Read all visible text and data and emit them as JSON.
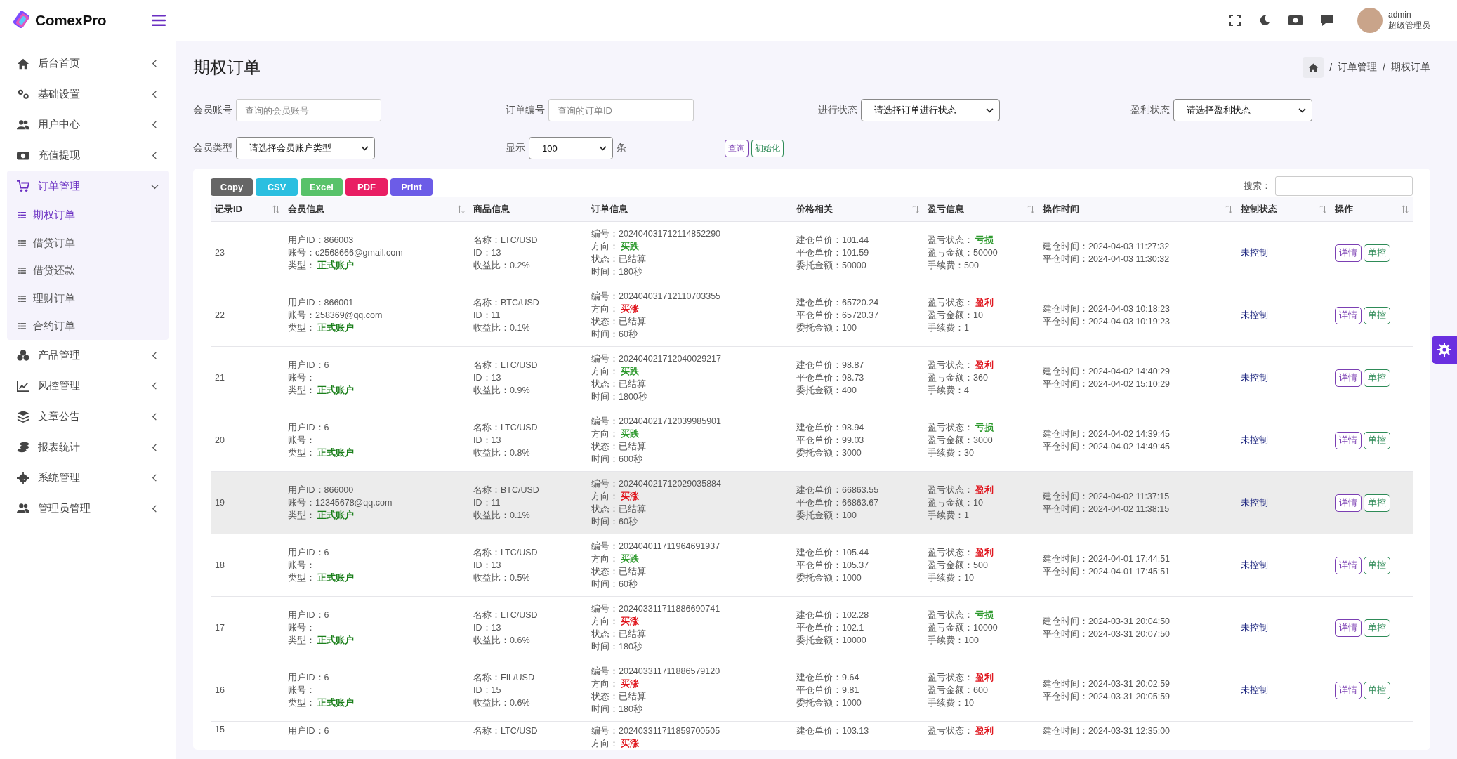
{
  "brand": "ComexPro",
  "sidebar": {
    "items": [
      {
        "label": "后台首页",
        "expanded": false
      },
      {
        "label": "基础设置",
        "expanded": false
      },
      {
        "label": "用户中心",
        "expanded": false
      },
      {
        "label": "充值提现",
        "expanded": false
      },
      {
        "label": "订单管理",
        "expanded": true,
        "children": [
          {
            "label": "期权订单",
            "selected": true
          },
          {
            "label": "借贷订单",
            "selected": false
          },
          {
            "label": "借贷还款",
            "selected": false
          },
          {
            "label": "理财订单",
            "selected": false
          },
          {
            "label": "合约订单",
            "selected": false
          }
        ]
      },
      {
        "label": "产品管理",
        "expanded": false
      },
      {
        "label": "风控管理",
        "expanded": false
      },
      {
        "label": "文章公告",
        "expanded": false
      },
      {
        "label": "报表统计",
        "expanded": false
      },
      {
        "label": "系统管理",
        "expanded": false
      },
      {
        "label": "管理员管理",
        "expanded": false
      }
    ]
  },
  "user": {
    "name": "admin",
    "role": "超级管理员"
  },
  "page_title": "期权订单",
  "breadcrumb": [
    "订单管理",
    "期权订单"
  ],
  "breadcrumb_separator": "/",
  "filter_rows": [
    [
      {
        "kind": "input",
        "label": "会员账号",
        "placeholder": "查询的会员账号"
      },
      {
        "kind": "input",
        "label": "订单编号",
        "placeholder": "查询的订单ID"
      },
      {
        "kind": "select",
        "label": "进行状态",
        "value": "请选择订单进行状态"
      },
      {
        "kind": "select",
        "label": "盈利状态",
        "value": "请选择盈利状态"
      }
    ],
    [
      {
        "kind": "select",
        "label": "会员类型",
        "value": "请选择会员账户类型"
      },
      {
        "kind": "select",
        "label": "显示",
        "value": "100",
        "suffix": "条"
      }
    ]
  ],
  "filter_buttons": [
    "查询",
    "初始化"
  ],
  "export_buttons": [
    "Copy",
    "CSV",
    "Excel",
    "PDF",
    "Print"
  ],
  "search_label": "搜索：",
  "table": {
    "columns": [
      {
        "label": "记录ID",
        "sortable": true
      },
      {
        "label": "会员信息",
        "sortable": true
      },
      {
        "label": "商品信息",
        "sortable": false
      },
      {
        "label": "订单信息",
        "sortable": false
      },
      {
        "label": "价格相关",
        "sortable": true
      },
      {
        "label": "盈亏信息",
        "sortable": true
      },
      {
        "label": "操作时间",
        "sortable": true
      },
      {
        "label": "控制状态",
        "sortable": true
      },
      {
        "label": "操作",
        "sortable": true
      }
    ],
    "rows": [
      {
        "id": "23",
        "highlighted": false,
        "member": [
          {
            "label": "用户ID：",
            "value": "866003"
          },
          {
            "label": "账号：",
            "value": "c2568666@gmail.com"
          },
          {
            "label": "类型： ",
            "value": "正式账户",
            "color": "#1a7f1a"
          }
        ],
        "product": [
          {
            "label": "名称：",
            "value": "LTC/USD"
          },
          {
            "label": "ID：",
            "value": "13"
          },
          {
            "label": "收益比：",
            "value": "0.2%"
          }
        ],
        "order": [
          {
            "label": "编号：",
            "value": "202404031712114852290"
          },
          {
            "label": "方向： ",
            "value": "买跌",
            "color": "#2e9a2e"
          },
          {
            "label": "状态：",
            "value": "已结算"
          },
          {
            "label": "时间：",
            "value": "180秒"
          }
        ],
        "price": [
          {
            "label": "建仓单价：",
            "value": "101.44"
          },
          {
            "label": "平仓单价：",
            "value": "101.59"
          },
          {
            "label": "委托金额：",
            "value": "50000"
          }
        ],
        "pnl": [
          {
            "label": "盈亏状态： ",
            "value": "亏损",
            "color": "#2e9a2e"
          },
          {
            "label": "盈亏金额：",
            "value": "50000"
          },
          {
            "label": "手续费：",
            "value": "500"
          }
        ],
        "time": [
          {
            "label": "建仓时间：",
            "value": "2024-04-03 11:27:32"
          },
          {
            "label": "平仓时间：",
            "value": "2024-04-03 11:30:32"
          }
        ],
        "control": "未控制",
        "actions": [
          "详情",
          "单控"
        ]
      },
      {
        "id": "22",
        "highlighted": false,
        "member": [
          {
            "label": "用户ID：",
            "value": "866001"
          },
          {
            "label": "账号：",
            "value": "258369@qq.com"
          },
          {
            "label": "类型： ",
            "value": "正式账户",
            "color": "#1a7f1a"
          }
        ],
        "product": [
          {
            "label": "名称：",
            "value": "BTC/USD"
          },
          {
            "label": "ID：",
            "value": "11"
          },
          {
            "label": "收益比：",
            "value": "0.1%"
          }
        ],
        "order": [
          {
            "label": "编号：",
            "value": "202404031712110703355"
          },
          {
            "label": "方向： ",
            "value": "买涨",
            "color": "#e0161e"
          },
          {
            "label": "状态：",
            "value": "已结算"
          },
          {
            "label": "时间：",
            "value": "60秒"
          }
        ],
        "price": [
          {
            "label": "建仓单价：",
            "value": "65720.24"
          },
          {
            "label": "平仓单价：",
            "value": "65720.37"
          },
          {
            "label": "委托金额：",
            "value": "100"
          }
        ],
        "pnl": [
          {
            "label": "盈亏状态： ",
            "value": "盈利",
            "color": "#e0161e"
          },
          {
            "label": "盈亏金额：",
            "value": "10"
          },
          {
            "label": "手续费：",
            "value": "1"
          }
        ],
        "time": [
          {
            "label": "建仓时间：",
            "value": "2024-04-03 10:18:23"
          },
          {
            "label": "平仓时间：",
            "value": "2024-04-03 10:19:23"
          }
        ],
        "control": "未控制",
        "actions": [
          "详情",
          "单控"
        ]
      },
      {
        "id": "21",
        "highlighted": false,
        "member": [
          {
            "label": "用户ID：",
            "value": "6"
          },
          {
            "label": "账号："
          },
          {
            "label": "类型： ",
            "value": "正式账户",
            "color": "#1a7f1a"
          }
        ],
        "product": [
          {
            "label": "名称：",
            "value": "LTC/USD"
          },
          {
            "label": "ID：",
            "value": "13"
          },
          {
            "label": "收益比：",
            "value": "0.9%"
          }
        ],
        "order": [
          {
            "label": "编号：",
            "value": "202404021712040029217"
          },
          {
            "label": "方向： ",
            "value": "买跌",
            "color": "#2e9a2e"
          },
          {
            "label": "状态：",
            "value": "已结算"
          },
          {
            "label": "时间：",
            "value": "1800秒"
          }
        ],
        "price": [
          {
            "label": "建仓单价：",
            "value": "98.87"
          },
          {
            "label": "平仓单价：",
            "value": "98.73"
          },
          {
            "label": "委托金额：",
            "value": "400"
          }
        ],
        "pnl": [
          {
            "label": "盈亏状态： ",
            "value": "盈利",
            "color": "#e0161e"
          },
          {
            "label": "盈亏金额：",
            "value": "360"
          },
          {
            "label": "手续费：",
            "value": "4"
          }
        ],
        "time": [
          {
            "label": "建仓时间：",
            "value": "2024-04-02 14:40:29"
          },
          {
            "label": "平仓时间：",
            "value": "2024-04-02 15:10:29"
          }
        ],
        "control": "未控制",
        "actions": [
          "详情",
          "单控"
        ]
      },
      {
        "id": "20",
        "highlighted": false,
        "member": [
          {
            "label": "用户ID：",
            "value": "6"
          },
          {
            "label": "账号："
          },
          {
            "label": "类型： ",
            "value": "正式账户",
            "color": "#1a7f1a"
          }
        ],
        "product": [
          {
            "label": "名称：",
            "value": "LTC/USD"
          },
          {
            "label": "ID：",
            "value": "13"
          },
          {
            "label": "收益比：",
            "value": "0.8%"
          }
        ],
        "order": [
          {
            "label": "编号：",
            "value": "202404021712039985901"
          },
          {
            "label": "方向： ",
            "value": "买跌",
            "color": "#2e9a2e"
          },
          {
            "label": "状态：",
            "value": "已结算"
          },
          {
            "label": "时间：",
            "value": "600秒"
          }
        ],
        "price": [
          {
            "label": "建仓单价：",
            "value": "98.94"
          },
          {
            "label": "平仓单价：",
            "value": "99.03"
          },
          {
            "label": "委托金额：",
            "value": "3000"
          }
        ],
        "pnl": [
          {
            "label": "盈亏状态： ",
            "value": "亏损",
            "color": "#2e9a2e"
          },
          {
            "label": "盈亏金额：",
            "value": "3000"
          },
          {
            "label": "手续费：",
            "value": "30"
          }
        ],
        "time": [
          {
            "label": "建仓时间：",
            "value": "2024-04-02 14:39:45"
          },
          {
            "label": "平仓时间：",
            "value": "2024-04-02 14:49:45"
          }
        ],
        "control": "未控制",
        "actions": [
          "详情",
          "单控"
        ]
      },
      {
        "id": "19",
        "highlighted": true,
        "member": [
          {
            "label": "用户ID：",
            "value": "866000"
          },
          {
            "label": "账号：",
            "value": "12345678@qq.com"
          },
          {
            "label": "类型： ",
            "value": "正式账户",
            "color": "#1a7f1a"
          }
        ],
        "product": [
          {
            "label": "名称：",
            "value": "BTC/USD"
          },
          {
            "label": "ID：",
            "value": "11"
          },
          {
            "label": "收益比：",
            "value": "0.1%"
          }
        ],
        "order": [
          {
            "label": "编号：",
            "value": "202404021712029035884"
          },
          {
            "label": "方向： ",
            "value": "买涨",
            "color": "#e0161e"
          },
          {
            "label": "状态：",
            "value": "已结算"
          },
          {
            "label": "时间：",
            "value": "60秒"
          }
        ],
        "price": [
          {
            "label": "建仓单价：",
            "value": "66863.55"
          },
          {
            "label": "平仓单价：",
            "value": "66863.67"
          },
          {
            "label": "委托金额：",
            "value": "100"
          }
        ],
        "pnl": [
          {
            "label": "盈亏状态： ",
            "value": "盈利",
            "color": "#e0161e"
          },
          {
            "label": "盈亏金额：",
            "value": "10"
          },
          {
            "label": "手续费：",
            "value": "1"
          }
        ],
        "time": [
          {
            "label": "建仓时间：",
            "value": "2024-04-02 11:37:15"
          },
          {
            "label": "平仓时间：",
            "value": "2024-04-02 11:38:15"
          }
        ],
        "control": "未控制",
        "actions": [
          "详情",
          "单控"
        ]
      },
      {
        "id": "18",
        "highlighted": false,
        "member": [
          {
            "label": "用户ID：",
            "value": "6"
          },
          {
            "label": "账号："
          },
          {
            "label": "类型： ",
            "value": "正式账户",
            "color": "#1a7f1a"
          }
        ],
        "product": [
          {
            "label": "名称：",
            "value": "LTC/USD"
          },
          {
            "label": "ID：",
            "value": "13"
          },
          {
            "label": "收益比：",
            "value": "0.5%"
          }
        ],
        "order": [
          {
            "label": "编号：",
            "value": "202404011711964691937"
          },
          {
            "label": "方向： ",
            "value": "买跌",
            "color": "#2e9a2e"
          },
          {
            "label": "状态：",
            "value": "已结算"
          },
          {
            "label": "时间：",
            "value": "60秒"
          }
        ],
        "price": [
          {
            "label": "建仓单价：",
            "value": "105.44"
          },
          {
            "label": "平仓单价：",
            "value": "105.37"
          },
          {
            "label": "委托金额：",
            "value": "1000"
          }
        ],
        "pnl": [
          {
            "label": "盈亏状态： ",
            "value": "盈利",
            "color": "#e0161e"
          },
          {
            "label": "盈亏金额：",
            "value": "500"
          },
          {
            "label": "手续费：",
            "value": "10"
          }
        ],
        "time": [
          {
            "label": "建仓时间：",
            "value": "2024-04-01 17:44:51"
          },
          {
            "label": "平仓时间：",
            "value": "2024-04-01 17:45:51"
          }
        ],
        "control": "未控制",
        "actions": [
          "详情",
          "单控"
        ]
      },
      {
        "id": "17",
        "highlighted": false,
        "member": [
          {
            "label": "用户ID：",
            "value": "6"
          },
          {
            "label": "账号："
          },
          {
            "label": "类型： ",
            "value": "正式账户",
            "color": "#1a7f1a"
          }
        ],
        "product": [
          {
            "label": "名称：",
            "value": "LTC/USD"
          },
          {
            "label": "ID：",
            "value": "13"
          },
          {
            "label": "收益比：",
            "value": "0.6%"
          }
        ],
        "order": [
          {
            "label": "编号：",
            "value": "202403311711886690741"
          },
          {
            "label": "方向： ",
            "value": "买涨",
            "color": "#e0161e"
          },
          {
            "label": "状态：",
            "value": "已结算"
          },
          {
            "label": "时间：",
            "value": "180秒"
          }
        ],
        "price": [
          {
            "label": "建仓单价：",
            "value": "102.28"
          },
          {
            "label": "平仓单价：",
            "value": "102.1"
          },
          {
            "label": "委托金额：",
            "value": "10000"
          }
        ],
        "pnl": [
          {
            "label": "盈亏状态： ",
            "value": "亏损",
            "color": "#2e9a2e"
          },
          {
            "label": "盈亏金额：",
            "value": "10000"
          },
          {
            "label": "手续费：",
            "value": "100"
          }
        ],
        "time": [
          {
            "label": "建仓时间：",
            "value": "2024-03-31 20:04:50"
          },
          {
            "label": "平仓时间：",
            "value": "2024-03-31 20:07:50"
          }
        ],
        "control": "未控制",
        "actions": [
          "详情",
          "单控"
        ]
      },
      {
        "id": "16",
        "highlighted": false,
        "member": [
          {
            "label": "用户ID：",
            "value": "6"
          },
          {
            "label": "账号："
          },
          {
            "label": "类型： ",
            "value": "正式账户",
            "color": "#1a7f1a"
          }
        ],
        "product": [
          {
            "label": "名称：",
            "value": "FIL/USD"
          },
          {
            "label": "ID：",
            "value": "15"
          },
          {
            "label": "收益比：",
            "value": "0.6%"
          }
        ],
        "order": [
          {
            "label": "编号：",
            "value": "202403311711886579120"
          },
          {
            "label": "方向： ",
            "value": "买涨",
            "color": "#e0161e"
          },
          {
            "label": "状态：",
            "value": "已结算"
          },
          {
            "label": "时间：",
            "value": "180秒"
          }
        ],
        "price": [
          {
            "label": "建仓单价：",
            "value": "9.64"
          },
          {
            "label": "平仓单价：",
            "value": "9.81"
          },
          {
            "label": "委托金额：",
            "value": "1000"
          }
        ],
        "pnl": [
          {
            "label": "盈亏状态： ",
            "value": "盈利",
            "color": "#e0161e"
          },
          {
            "label": "盈亏金额：",
            "value": "600"
          },
          {
            "label": "手续费：",
            "value": "10"
          }
        ],
        "time": [
          {
            "label": "建仓时间：",
            "value": "2024-03-31 20:02:59"
          },
          {
            "label": "平仓时间：",
            "value": "2024-03-31 20:05:59"
          }
        ],
        "control": "未控制",
        "actions": [
          "详情",
          "单控"
        ]
      },
      {
        "id": "15",
        "highlighted": false,
        "member": [
          {
            "label": "用户ID：",
            "value": "6"
          }
        ],
        "product": [
          {
            "label": "名称：",
            "value": "LTC/USD"
          }
        ],
        "order": [
          {
            "label": "编号：",
            "value": "202403311711859700505"
          },
          {
            "label": "方向： ",
            "value": "买涨",
            "color": "#e0161e"
          }
        ],
        "price": [
          {
            "label": "建仓单价：",
            "value": "103.13"
          }
        ],
        "pnl": [
          {
            "label": "盈亏状态： ",
            "value": "盈利",
            "color": "#e0161e"
          }
        ],
        "time": [
          {
            "label": "建仓时间：",
            "value": "2024-03-31 12:35:00"
          }
        ]
      }
    ]
  }
}
